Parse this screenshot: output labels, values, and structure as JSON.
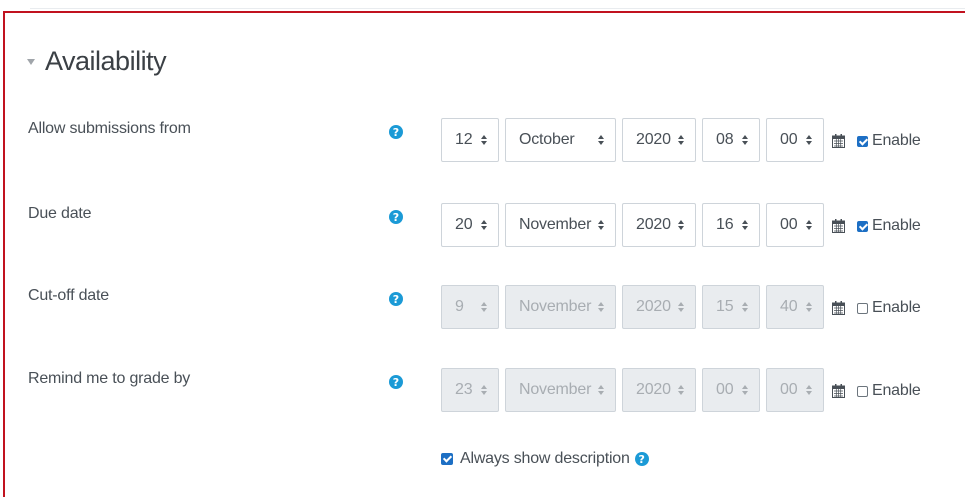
{
  "section": {
    "title": "Availability"
  },
  "rows": [
    {
      "label": "Allow submissions from",
      "day": "12",
      "month": "October",
      "year": "2020",
      "hour": "08",
      "minute": "00",
      "enable_label": "Enable",
      "enabled": true
    },
    {
      "label": "Due date",
      "day": "20",
      "month": "November",
      "year": "2020",
      "hour": "16",
      "minute": "00",
      "enable_label": "Enable",
      "enabled": true
    },
    {
      "label": "Cut-off date",
      "day": "9",
      "month": "November",
      "year": "2020",
      "hour": "15",
      "minute": "40",
      "enable_label": "Enable",
      "enabled": false
    },
    {
      "label": "Remind me to grade by",
      "day": "23",
      "month": "November",
      "year": "2020",
      "hour": "00",
      "minute": "00",
      "enable_label": "Enable",
      "enabled": false
    }
  ],
  "help_glyph": "?",
  "always_show": {
    "label": "Always show description",
    "checked": true
  },
  "colors": {
    "frame": "#c1121f",
    "help": "#1b9ad6",
    "checkbox": "#1d6fc4"
  }
}
